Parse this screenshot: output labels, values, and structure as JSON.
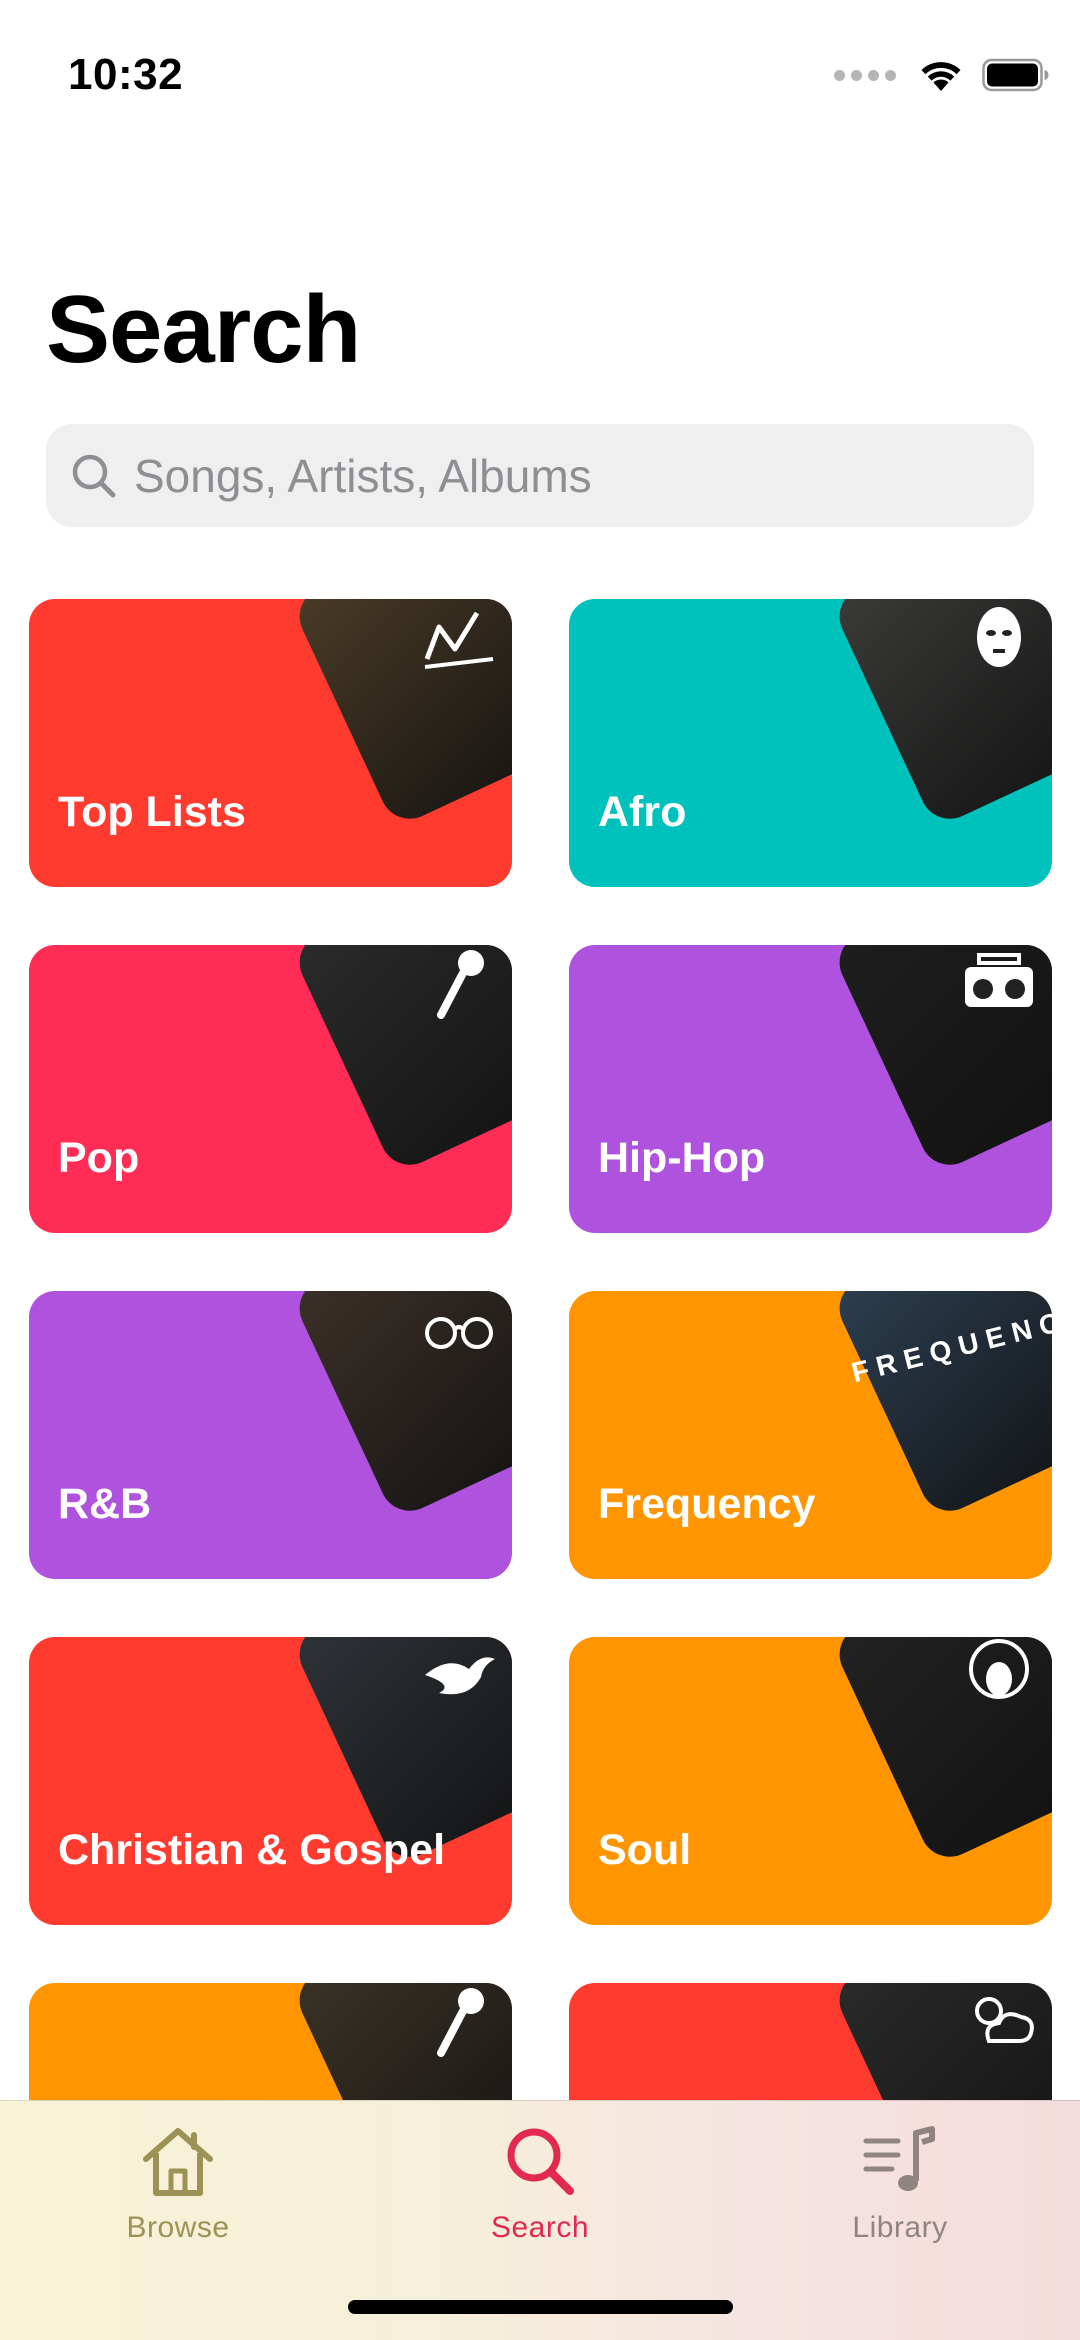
{
  "status_bar": {
    "time": "10:32"
  },
  "page": {
    "title": "Search"
  },
  "search": {
    "placeholder": "Songs, Artists, Albums",
    "value": ""
  },
  "genres": [
    {
      "label": "Top Lists",
      "color": "#ff3b30",
      "art_color": "#4a3b26",
      "icon": "chart-line-icon"
    },
    {
      "label": "Afro",
      "color": "#00c2bd",
      "art_color": "#3a3a38",
      "icon": "african-mask-icon"
    },
    {
      "label": "Pop",
      "color": "#ff2d55",
      "art_color": "#2b2b2b",
      "icon": "microphone-icon"
    },
    {
      "label": "Hip-Hop",
      "color": "#af52de",
      "art_color": "#1e1e1e",
      "icon": "boombox-icon"
    },
    {
      "label": "R&B",
      "color": "#af52de",
      "art_color": "#3b3028",
      "icon": "sunglasses-icon"
    },
    {
      "label": "Frequency",
      "color": "#ff9500",
      "art_color": "#2c3e50",
      "icon": "frequency-wordmark"
    },
    {
      "label": "Christian & Gospel",
      "color": "#ff3b30",
      "art_color": "#2e3338",
      "icon": "dove-icon"
    },
    {
      "label": "Soul",
      "color": "#ff9500",
      "art_color": "#222222",
      "icon": "afro-woman-icon"
    },
    {
      "label": "",
      "color": "#ff9500",
      "art_color": "#3a3226",
      "icon": "microphone-icon"
    },
    {
      "label": "",
      "color": "#ff3b30",
      "art_color": "#2a2a2a",
      "icon": "weather-cloud-icon"
    }
  ],
  "frequency_art_text": "FREQUENC",
  "tab_bar": {
    "tabs": [
      {
        "label": "Browse",
        "icon": "house-icon",
        "selected": false,
        "color": "#9d9256"
      },
      {
        "label": "Search",
        "icon": "search-icon",
        "selected": true,
        "color": "#e2294f"
      },
      {
        "label": "Library",
        "icon": "music-library-icon",
        "selected": false,
        "color": "#8f8480"
      }
    ]
  }
}
